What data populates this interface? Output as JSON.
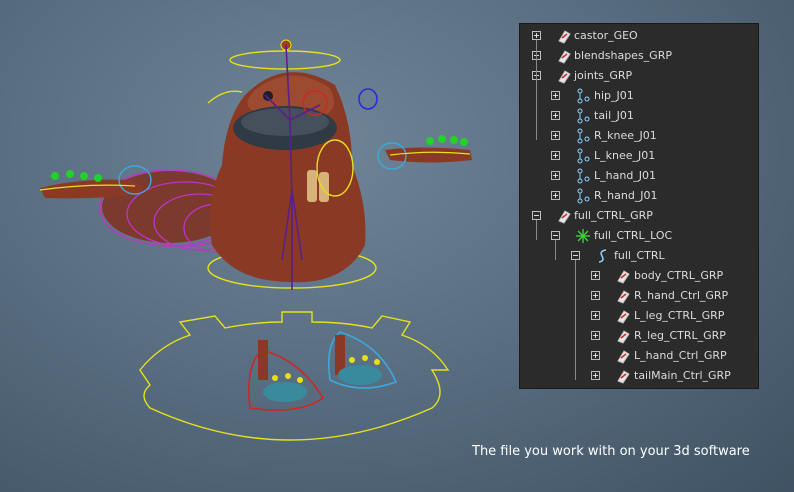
{
  "colors": {
    "background_center": "#6f8496",
    "background_edge": "#3f5263",
    "outliner_bg": "#2b2b2b",
    "outliner_text": "#dcdcdc",
    "control_yellow": "#e6e01c",
    "joint_purple": "#5a1f8c",
    "character_body": "#8a3a24"
  },
  "outliner": {
    "items": [
      {
        "label": "castor_GEO",
        "icon": "mesh-transform-icon",
        "expander": "plus"
      },
      {
        "label": "blendshapes_GRP",
        "icon": "mesh-transform-icon",
        "expander": "plus"
      },
      {
        "label": "joints_GRP",
        "icon": "mesh-transform-icon",
        "expander": "minus"
      },
      {
        "label": "hip_J01",
        "icon": "joint-icon",
        "expander": "plus"
      },
      {
        "label": "tail_J01",
        "icon": "joint-icon",
        "expander": "plus"
      },
      {
        "label": "R_knee_J01",
        "icon": "joint-icon",
        "expander": "plus"
      },
      {
        "label": "L_knee_J01",
        "icon": "joint-icon",
        "expander": "plus"
      },
      {
        "label": "L_hand_J01",
        "icon": "joint-icon",
        "expander": "plus"
      },
      {
        "label": "R_hand_J01",
        "icon": "joint-icon",
        "expander": "plus"
      },
      {
        "label": "full_CTRL_GRP",
        "icon": "mesh-transform-icon",
        "expander": "minus"
      },
      {
        "label": "full_CTRL_LOC",
        "icon": "locator-icon",
        "expander": "minus"
      },
      {
        "label": "full_CTRL",
        "icon": "curve-icon",
        "expander": "minus"
      },
      {
        "label": "body_CTRL_GRP",
        "icon": "mesh-transform-icon",
        "expander": "plus"
      },
      {
        "label": "R_hand_Ctrl_GRP",
        "icon": "mesh-transform-icon",
        "expander": "plus"
      },
      {
        "label": "L_leg_CTRL_GRP",
        "icon": "mesh-transform-icon",
        "expander": "plus"
      },
      {
        "label": "R_leg_CTRL_GRP",
        "icon": "mesh-transform-icon",
        "expander": "plus"
      },
      {
        "label": "L_hand_Ctrl_GRP",
        "icon": "mesh-transform-icon",
        "expander": "plus"
      },
      {
        "label": "tailMain_Ctrl_GRP",
        "icon": "mesh-transform-icon",
        "expander": "plus"
      }
    ]
  },
  "caption": "The file you work with on your 3d software"
}
